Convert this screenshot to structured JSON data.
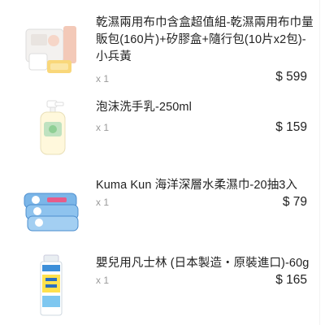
{
  "cart": {
    "items": [
      {
        "title": "乾濕兩用布巾含盒超值組-乾濕兩用布巾量販包(160片)+矽膠盒+隨行包(10片x2包)-小兵黃",
        "qty": "x 1",
        "price": "$ 599",
        "icon": "wipes-box-set-icon"
      },
      {
        "title": "泡沫洗手乳-250ml",
        "qty": "x 1",
        "price": "$ 159",
        "icon": "foam-soap-bottle-icon"
      },
      {
        "title": "Kuma Kun 海洋深層水柔濕巾-20抽3入",
        "qty": "x 1",
        "price": "$ 79",
        "icon": "wet-wipes-pack-icon"
      },
      {
        "title": "嬰兒用凡士林 (日本製造・原裝進口)-60g",
        "qty": "x 1",
        "price": "$ 165",
        "icon": "vaseline-tube-icon"
      }
    ]
  }
}
